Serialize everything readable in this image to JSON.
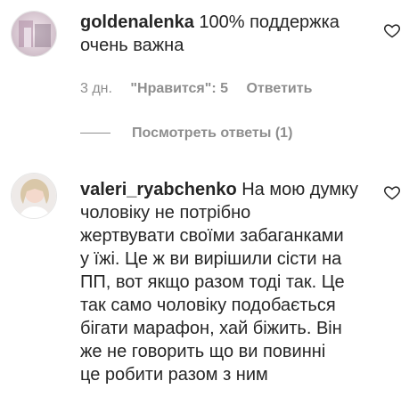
{
  "comments": [
    {
      "username": "goldenalenka",
      "lines": [
        "100% поддержка",
        "очень важна"
      ],
      "time": "3 дн.",
      "likes": "\"Нравится\": 5",
      "reply_label": "Ответить",
      "view_replies": "Посмотреть ответы (1)",
      "avatar_icon": "profile-photo"
    },
    {
      "username": "valeri_ryabchenko",
      "lines": [
        "На мою думку",
        "чоловіку не потрібно",
        "жертвувати своїми забаганками",
        "у їжі. Це ж ви вирішили сісти на",
        "ПП, вот якщо разом тоді так. Це",
        "так само чоловіку подобається",
        "бігати марафон, хай біжить. Він",
        "же не говорить що ви повинні",
        "це робити разом з ним"
      ],
      "avatar_icon": "profile-photo"
    }
  ],
  "icons": {
    "like": "heart-outline-icon"
  }
}
